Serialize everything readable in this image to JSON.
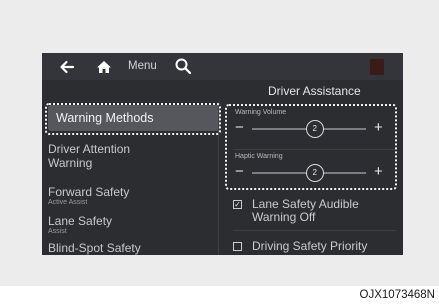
{
  "topbar": {
    "back_icon": "back-arrow-icon",
    "home_icon": "home-icon",
    "menu_label": "Menu",
    "search_icon": "search-icon"
  },
  "header": {
    "title": "Driver Assistance"
  },
  "menu": {
    "items": [
      {
        "label": "Warning Methods",
        "sub": ""
      },
      {
        "label": "Driver Attention Warning",
        "sub": ""
      },
      {
        "label": "Forward Safety",
        "sub": "Active Assist"
      },
      {
        "label": "Lane Safety",
        "sub": "Assist"
      },
      {
        "label": "Blind-Spot Safety",
        "sub": ""
      }
    ]
  },
  "settings": {
    "warning_volume": {
      "label": "Warning Volume",
      "value": "2",
      "level": 0.55
    },
    "haptic_warning": {
      "label": "Haptic Warning",
      "value": "2",
      "level": 0.55
    },
    "minus": "−",
    "plus": "+",
    "lane_safety_audible": {
      "label": "Lane Safety Audible Warning Off",
      "checked": true
    },
    "driving_safety_priority": {
      "label": "Driving Safety Priority",
      "checked": false
    }
  },
  "caption": "OJX1073468N"
}
